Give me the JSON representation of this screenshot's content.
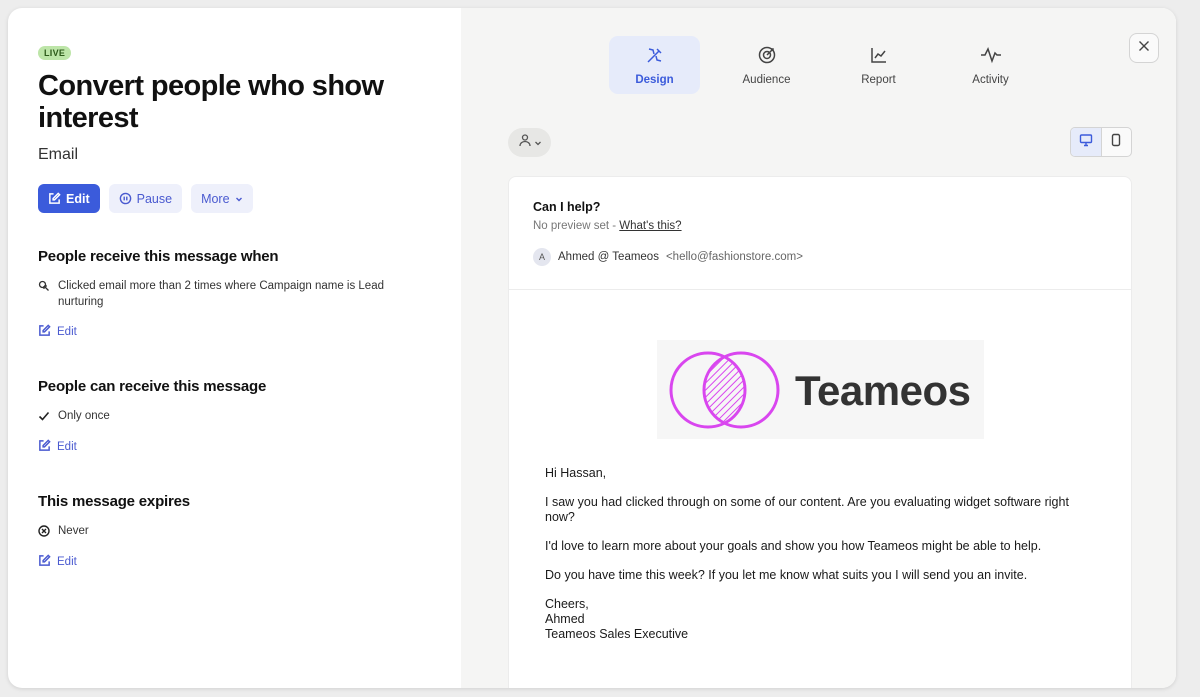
{
  "header": {
    "status_badge": "LIVE",
    "title": "Convert people who show interest",
    "channel": "Email"
  },
  "actions": {
    "edit_label": "Edit",
    "pause_label": "Pause",
    "more_label": "More"
  },
  "sections": {
    "receive_when": {
      "title": "People receive this message when",
      "rule": "Clicked email more than 2 times where Campaign name is Lead nurturing",
      "edit_label": "Edit"
    },
    "can_receive": {
      "title": "People can receive this message",
      "rule": "Only once",
      "edit_label": "Edit"
    },
    "expires": {
      "title": "This message expires",
      "rule": "Never",
      "edit_label": "Edit"
    }
  },
  "tabs": [
    {
      "label": "Design",
      "icon": "design-icon",
      "active": true
    },
    {
      "label": "Audience",
      "icon": "target-icon",
      "active": false
    },
    {
      "label": "Report",
      "icon": "chart-icon",
      "active": false
    },
    {
      "label": "Activity",
      "icon": "pulse-icon",
      "active": false
    }
  ],
  "preview_toolbar": {
    "persona_icon": "person-icon",
    "device_options": [
      "desktop",
      "mobile"
    ],
    "selected_device": "desktop"
  },
  "email": {
    "subject": "Can I help?",
    "preview_text": "No preview set - ",
    "preview_link": "What's this?",
    "sender_initial": "A",
    "sender_name": "Ahmed @ Teameos",
    "sender_address": "<hello@fashionstore.com>",
    "logo_text": "Teameos",
    "greeting": "Hi Hassan,",
    "paragraphs": [
      "I saw you had clicked through on some of our content. Are you evaluating widget software right now?",
      "I'd love to learn more about your goals and show you how Teameos might be able to help.",
      "Do you have time this week? If you let me know what suits you I will send you an invite."
    ],
    "signoff": "Cheers,",
    "signature_name": "Ahmed",
    "signature_title": "Teameos Sales Executive"
  },
  "colors": {
    "accent": "#3b5bdb",
    "live_badge_bg": "#bde5a8",
    "logo_magenta": "#d946ef"
  }
}
